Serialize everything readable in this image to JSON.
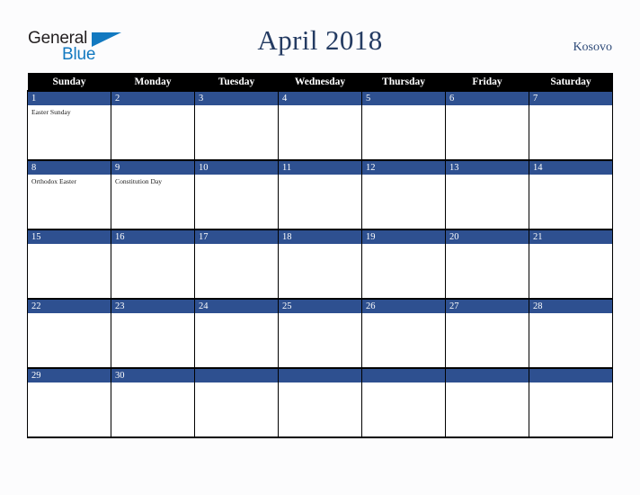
{
  "header": {
    "logo": {
      "word_one": "General",
      "word_two": "Blue",
      "triangle_icon": "blue-triangle-icon",
      "color_dark": "#231f20",
      "color_blue": "#1279c0"
    },
    "title": "April 2018",
    "country": "Kosovo"
  },
  "calendar": {
    "month": "April",
    "year": "2018",
    "accent_color": "#2e5090",
    "header_bg": "#000000",
    "weekday_headers": [
      "Sunday",
      "Monday",
      "Tuesday",
      "Wednesday",
      "Thursday",
      "Friday",
      "Saturday"
    ],
    "weeks": [
      {
        "days": [
          {
            "num": "1",
            "events": [
              "Easter Sunday"
            ]
          },
          {
            "num": "2",
            "events": []
          },
          {
            "num": "3",
            "events": []
          },
          {
            "num": "4",
            "events": []
          },
          {
            "num": "5",
            "events": []
          },
          {
            "num": "6",
            "events": []
          },
          {
            "num": "7",
            "events": []
          }
        ]
      },
      {
        "days": [
          {
            "num": "8",
            "events": [
              "Orthodox Easter"
            ]
          },
          {
            "num": "9",
            "events": [
              "Constitution Day"
            ]
          },
          {
            "num": "10",
            "events": []
          },
          {
            "num": "11",
            "events": []
          },
          {
            "num": "12",
            "events": []
          },
          {
            "num": "13",
            "events": []
          },
          {
            "num": "14",
            "events": []
          }
        ]
      },
      {
        "days": [
          {
            "num": "15",
            "events": []
          },
          {
            "num": "16",
            "events": []
          },
          {
            "num": "17",
            "events": []
          },
          {
            "num": "18",
            "events": []
          },
          {
            "num": "19",
            "events": []
          },
          {
            "num": "20",
            "events": []
          },
          {
            "num": "21",
            "events": []
          }
        ]
      },
      {
        "days": [
          {
            "num": "22",
            "events": []
          },
          {
            "num": "23",
            "events": []
          },
          {
            "num": "24",
            "events": []
          },
          {
            "num": "25",
            "events": []
          },
          {
            "num": "26",
            "events": []
          },
          {
            "num": "27",
            "events": []
          },
          {
            "num": "28",
            "events": []
          }
        ]
      },
      {
        "days": [
          {
            "num": "29",
            "events": []
          },
          {
            "num": "30",
            "events": []
          },
          {
            "num": "",
            "events": []
          },
          {
            "num": "",
            "events": []
          },
          {
            "num": "",
            "events": []
          },
          {
            "num": "",
            "events": []
          },
          {
            "num": "",
            "events": []
          }
        ]
      }
    ]
  }
}
